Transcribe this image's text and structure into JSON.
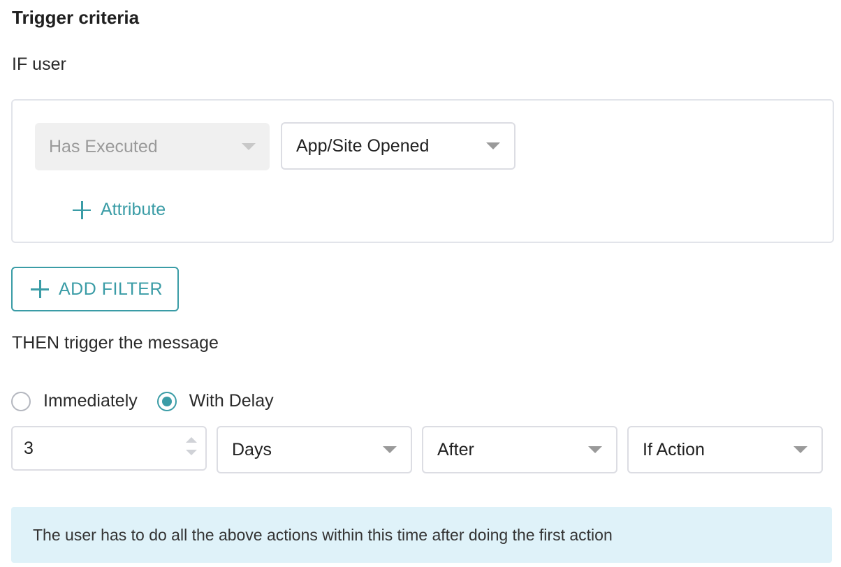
{
  "title": "Trigger criteria",
  "if_label": "IF user",
  "criteria": {
    "condition_select": {
      "value": "Has Executed",
      "disabled": true
    },
    "event_select": {
      "value": "App/Site Opened"
    },
    "add_attribute_label": "Attribute"
  },
  "add_filter_label": "ADD FILTER",
  "then_label": "THEN trigger the message",
  "timing": {
    "options": [
      {
        "label": "Immediately",
        "checked": false
      },
      {
        "label": "With Delay",
        "checked": true
      }
    ],
    "delay_value": "3",
    "unit_select": "Days",
    "relation_select": "After",
    "reference_select": "If Action"
  },
  "info_text": "The user has to do all the above actions within this time after doing the first action",
  "colors": {
    "accent": "#3a9ca6",
    "info_bg": "#dff2f9",
    "disabled_bg": "#f0f0f0",
    "border": "#dcdde3"
  }
}
